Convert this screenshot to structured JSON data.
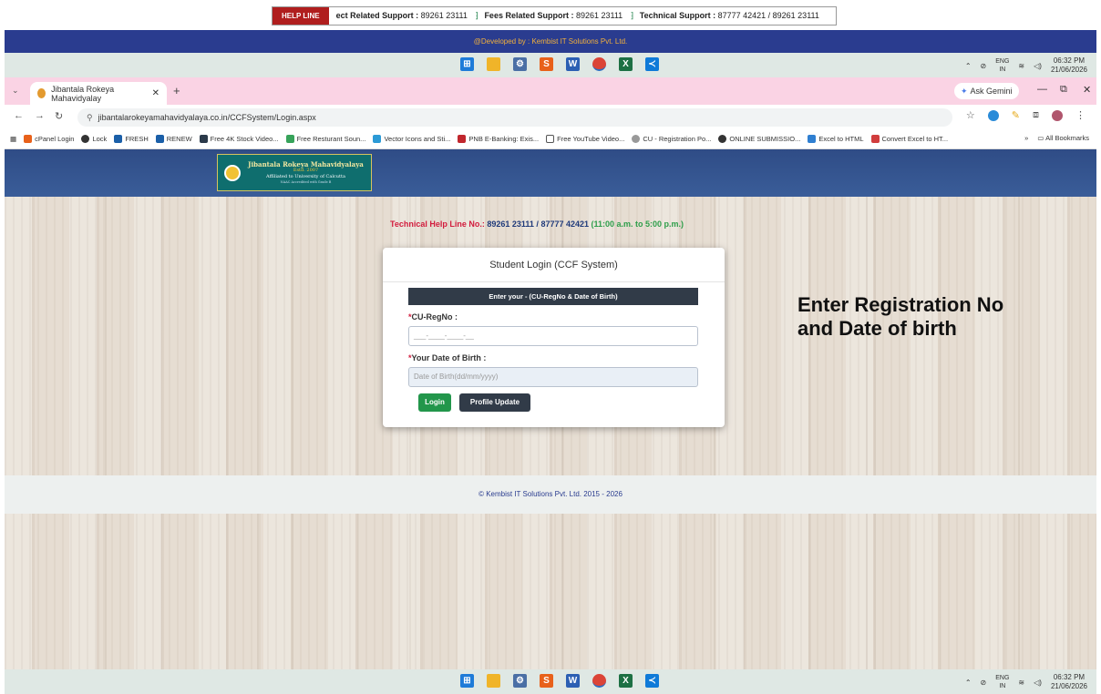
{
  "helpline": {
    "tag": "HELP LINE",
    "ticker": {
      "subject_label": "ect Related Support :",
      "subject_number": "89261 23111",
      "fees_label": "Fees Related Support :",
      "fees_number": "89261 23111",
      "tech_label": "Technical Support :",
      "tech_number": "87777 42421 / 89261 23111"
    }
  },
  "developer_bar": "@Developed by : Kembist IT Solutions Pvt. Ltd.",
  "taskbar": {
    "lang_top": "ENG",
    "lang_bottom": "IN",
    "time": "06:32 PM",
    "date": "21/06/2026"
  },
  "browser": {
    "tab_title": "Jibantala Rokeya Mahavidyalay",
    "gemini": "Ask Gemini",
    "url": "jibantalarokeyamahavidyalaya.co.in/CCFSystem/Login.aspx",
    "bookmarks": [
      "cPanel Login",
      "Lock",
      "FRESH",
      "RENEW",
      "Free 4K Stock Video...",
      "Free Resturant Soun...",
      "Vector Icons and Sti...",
      "PNB E-Banking: Exis...",
      "Free YouTube Video...",
      "CU - Registration Po...",
      "ONLINE SUBMISSIO...",
      "Excel to HTML",
      "Convert Excel to HT..."
    ],
    "all_bookmarks": "All Bookmarks"
  },
  "logo": {
    "name": "Jibantala Rokeya Mahavidyalaya",
    "estd": "Estd. 2007",
    "affiliation": "Affiliated to University of Calcutta",
    "accreditation": "NAAC Accredited with Grade B"
  },
  "help_line_no": {
    "label": "Technical Help Line No.:",
    "numbers": "89261 23111  /  87777 42421",
    "hours": "(11:00 a.m. to 5:00 p.m.)"
  },
  "login": {
    "title": "Student Login (CCF System)",
    "subtitle": "Enter your - (CU-RegNo & Date of Birth)",
    "regno_label": "CU-RegNo :",
    "regno_placeholder": "___-____-____-__",
    "dob_label": "Your Date of Birth :",
    "dob_placeholder": "Date of Birth(dd/mm/yyyy)",
    "login_button": "Login",
    "profile_button": "Profile Update"
  },
  "annotation": {
    "line1": "Enter Registration No",
    "line2": "and Date of birth"
  },
  "footer": "© Kembist IT Solutions Pvt. Ltd.  2015 - 2026",
  "colors": {
    "dev_bar": "#2a3c8f",
    "helpline_red": "#d21c3d",
    "login_green": "#22964b",
    "dark_btn": "#313b48"
  }
}
